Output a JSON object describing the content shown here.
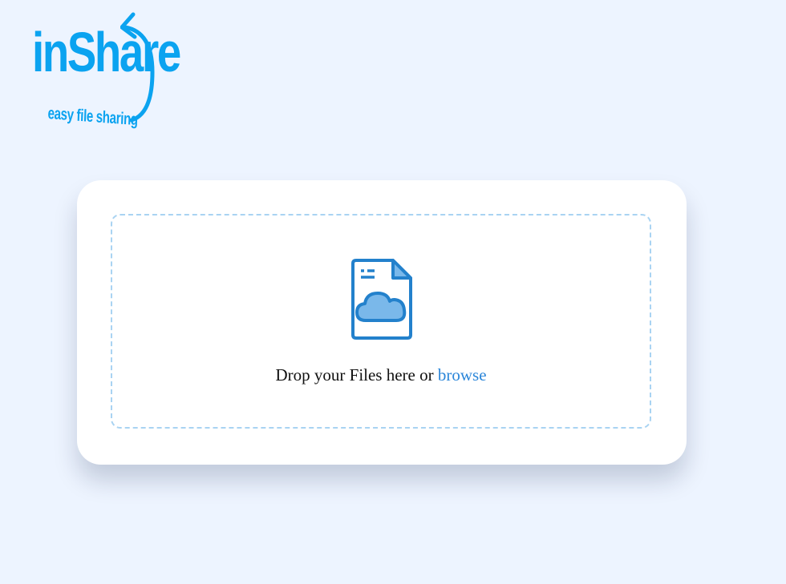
{
  "logo": {
    "wordmark": "inShare",
    "tagline": "easy file sharing",
    "color": "#0ba3f0"
  },
  "upload": {
    "icon": "file-cloud-icon",
    "drop_text": "Drop your Files here or",
    "browse_label": "browse",
    "accent": "#2b86d9",
    "border_color": "#a9d3f2"
  },
  "background": "#edf4ff"
}
